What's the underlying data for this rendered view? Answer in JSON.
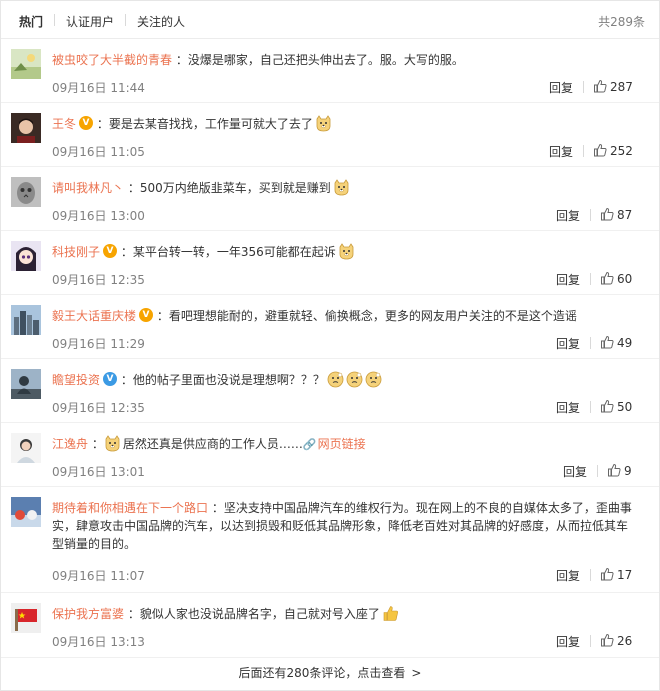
{
  "tabs": [
    {
      "label": "热门",
      "active": true
    },
    {
      "label": "认证用户",
      "active": false
    },
    {
      "label": "关注的人",
      "active": false
    }
  ],
  "total": "共289条",
  "comments": [
    {
      "user": "被虫咬了大半截的青春",
      "text": "没爆是哪家，自己还把头伸出去了。服。大写的服。",
      "time": "09月16日 11:44",
      "reply": "回复",
      "likes": "287",
      "badge": "none",
      "emojis_after": 0
    },
    {
      "user": "王冬",
      "text": "要是去某音找找，工作量可就大了去了",
      "time": "09月16日 11:05",
      "reply": "回复",
      "likes": "252",
      "badge": "gold",
      "emojis_after": 1
    },
    {
      "user": "请叫我林凡丶",
      "text": "500万内绝版韭菜车，买到就是赚到",
      "time": "09月16日 13:00",
      "reply": "回复",
      "likes": "87",
      "badge": "none",
      "emojis_after": 1
    },
    {
      "user": "科技刚子",
      "text": "某平台转一转，一年356可能都在起诉",
      "time": "09月16日 12:35",
      "reply": "回复",
      "likes": "60",
      "badge": "gold",
      "emojis_after": 1
    },
    {
      "user": "毅王大话重庆楼",
      "text": "看吧理想能耐的，避重就轻、偷换概念，更多的网友用户关注的不是这个造谣",
      "time": "09月16日 11:29",
      "reply": "回复",
      "likes": "49",
      "badge": "gold",
      "emojis_after": 0
    },
    {
      "user": "瞻望投资",
      "text": "他的帖子里面也没说是理想啊？？？",
      "time": "09月16日 12:35",
      "reply": "回复",
      "likes": "50",
      "badge": "blue",
      "emojis_after": 3
    },
    {
      "user": "江逸舟",
      "text": "居然还真是供应商的工作人员……",
      "link": "网页链接",
      "time": "09月16日 13:01",
      "reply": "回复",
      "likes": "9",
      "badge": "none",
      "emojis_before": 1
    },
    {
      "user": "期待着和你相遇在下一个路口",
      "text": "坚决支持中国品牌汽车的维权行为。现在网上的不良的自媒体太多了，歪曲事实，肆意攻击中国品牌的汽车，以达到损毁和贬低其品牌形象，降低老百姓对其品牌的好感度，从而拉低其车型销量的目的。",
      "time": "09月16日 11:07",
      "reply": "回复",
      "likes": "17",
      "badge": "none",
      "emojis_after": 0
    },
    {
      "user": "保护我方富婆",
      "text": "貌似人家也没说品牌名字，自己就对号入座了",
      "time": "09月16日 13:13",
      "reply": "回复",
      "likes": "26",
      "badge": "none",
      "emojis_after": 0,
      "thumb_emoji": true
    }
  ],
  "more_label": "后面还有280条评论，点击查看",
  "colors": {
    "username": "#eb7350",
    "time": "#808080",
    "text": "#333333",
    "gold_badge": "#f7a400",
    "blue_badge": "#3b9ae4"
  },
  "icons": {
    "like": "thumbs-up-icon",
    "emoji": "doge-emoji-icon",
    "link": "link-icon",
    "more": "chevron-right-icon"
  }
}
